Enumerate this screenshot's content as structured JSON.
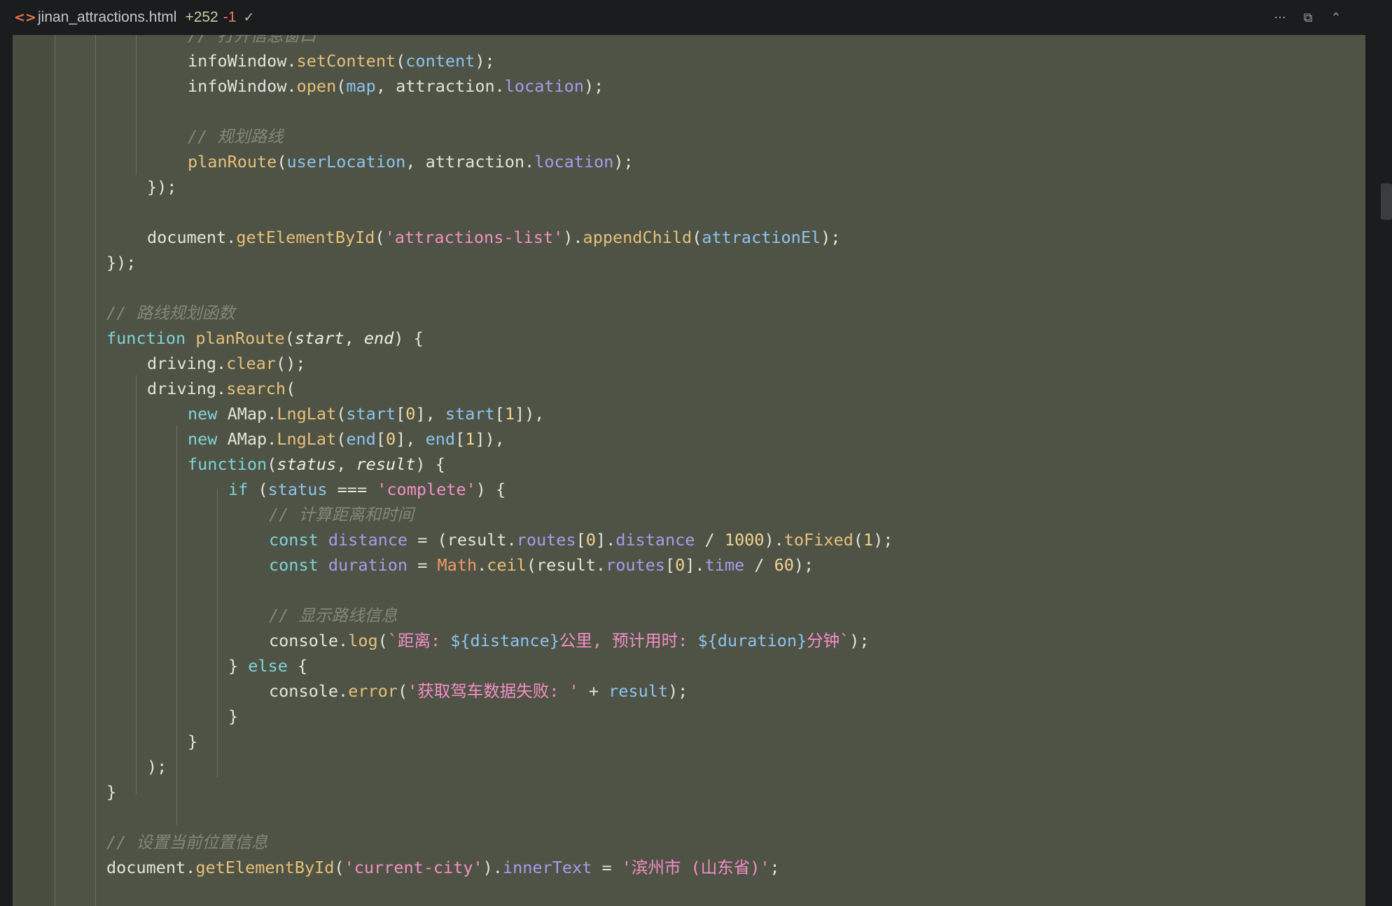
{
  "tab": {
    "file_icon": "code-icon",
    "filename": "jinan_attractions.html",
    "added": "+252",
    "removed": "-1",
    "status_icon": "check-icon",
    "status_glyph": "✓"
  },
  "toolbar": {
    "more_glyph": "···",
    "copy_glyph": "⧉",
    "expand_glyph": "⌃"
  },
  "code_lines": [
    [
      {
        "t": "// 打开信息窗口",
        "c": "c"
      }
    ],
    [
      {
        "t": "infoWindow."
      },
      {
        "t": "setContent",
        "c": "f"
      },
      {
        "t": "("
      },
      {
        "t": "content",
        "c": "p"
      },
      {
        "t": ");"
      }
    ],
    [
      {
        "t": "infoWindow."
      },
      {
        "t": "open",
        "c": "f"
      },
      {
        "t": "("
      },
      {
        "t": "map",
        "c": "p"
      },
      {
        "t": ", attraction."
      },
      {
        "t": "location",
        "c": "pr"
      },
      {
        "t": ");"
      }
    ],
    [],
    [
      {
        "t": "// 规划路线",
        "c": "c"
      }
    ],
    [
      {
        "t": "planRoute",
        "c": "f"
      },
      {
        "t": "("
      },
      {
        "t": "userLocation",
        "c": "p"
      },
      {
        "t": ", attraction."
      },
      {
        "t": "location",
        "c": "pr"
      },
      {
        "t": ");"
      }
    ],
    [
      {
        "t": "});"
      }
    ],
    [],
    [
      {
        "t": "document."
      },
      {
        "t": "getElementById",
        "c": "f"
      },
      {
        "t": "("
      },
      {
        "t": "'attractions-list'",
        "c": "s"
      },
      {
        "t": ")."
      },
      {
        "t": "appendChild",
        "c": "f"
      },
      {
        "t": "("
      },
      {
        "t": "attractionEl",
        "c": "p"
      },
      {
        "t": ");"
      }
    ],
    [
      {
        "t": "});"
      }
    ],
    [],
    [
      {
        "t": "// 路线规划函数",
        "c": "c"
      }
    ],
    [
      {
        "t": "function ",
        "c": "k"
      },
      {
        "t": "planRoute",
        "c": "f"
      },
      {
        "t": "("
      },
      {
        "t": "start",
        "c": "i"
      },
      {
        "t": ", "
      },
      {
        "t": "end",
        "c": "i"
      },
      {
        "t": ") {"
      }
    ],
    [
      {
        "t": "driving."
      },
      {
        "t": "clear",
        "c": "f"
      },
      {
        "t": "();"
      }
    ],
    [
      {
        "t": "driving."
      },
      {
        "t": "search",
        "c": "f"
      },
      {
        "t": "("
      }
    ],
    [
      {
        "t": "new ",
        "c": "k"
      },
      {
        "t": "AMap."
      },
      {
        "t": "LngLat",
        "c": "f"
      },
      {
        "t": "("
      },
      {
        "t": "start",
        "c": "p"
      },
      {
        "t": "["
      },
      {
        "t": "0",
        "c": "n"
      },
      {
        "t": "], "
      },
      {
        "t": "start",
        "c": "p"
      },
      {
        "t": "["
      },
      {
        "t": "1",
        "c": "n"
      },
      {
        "t": "]),"
      }
    ],
    [
      {
        "t": "new ",
        "c": "k"
      },
      {
        "t": "AMap."
      },
      {
        "t": "LngLat",
        "c": "f"
      },
      {
        "t": "("
      },
      {
        "t": "end",
        "c": "p"
      },
      {
        "t": "["
      },
      {
        "t": "0",
        "c": "n"
      },
      {
        "t": "], "
      },
      {
        "t": "end",
        "c": "p"
      },
      {
        "t": "["
      },
      {
        "t": "1",
        "c": "n"
      },
      {
        "t": "]),"
      }
    ],
    [
      {
        "t": "function",
        "c": "k"
      },
      {
        "t": "("
      },
      {
        "t": "status",
        "c": "i"
      },
      {
        "t": ", "
      },
      {
        "t": "result",
        "c": "i"
      },
      {
        "t": ") {"
      }
    ],
    [
      {
        "t": "if ",
        "c": "k"
      },
      {
        "t": "("
      },
      {
        "t": "status",
        "c": "p"
      },
      {
        "t": " === "
      },
      {
        "t": "'complete'",
        "c": "s"
      },
      {
        "t": ") {"
      }
    ],
    [
      {
        "t": "// 计算距离和时间",
        "c": "c"
      }
    ],
    [
      {
        "t": "const ",
        "c": "k"
      },
      {
        "t": "distance",
        "c": "pr"
      },
      {
        "t": " = (result."
      },
      {
        "t": "routes",
        "c": "pr"
      },
      {
        "t": "["
      },
      {
        "t": "0",
        "c": "n"
      },
      {
        "t": "]."
      },
      {
        "t": "distance",
        "c": "pr"
      },
      {
        "t": " / "
      },
      {
        "t": "1000",
        "c": "n"
      },
      {
        "t": ")."
      },
      {
        "t": "toFixed",
        "c": "f"
      },
      {
        "t": "("
      },
      {
        "t": "1",
        "c": "n"
      },
      {
        "t": ");"
      }
    ],
    [
      {
        "t": "const ",
        "c": "k"
      },
      {
        "t": "duration",
        "c": "pr"
      },
      {
        "t": " = "
      },
      {
        "t": "Math",
        "c": "o"
      },
      {
        "t": "."
      },
      {
        "t": "ceil",
        "c": "f"
      },
      {
        "t": "(result."
      },
      {
        "t": "routes",
        "c": "pr"
      },
      {
        "t": "["
      },
      {
        "t": "0",
        "c": "n"
      },
      {
        "t": "]."
      },
      {
        "t": "time",
        "c": "pr"
      },
      {
        "t": " / "
      },
      {
        "t": "60",
        "c": "n"
      },
      {
        "t": ");"
      }
    ],
    [],
    [
      {
        "t": "// 显示路线信息",
        "c": "c"
      }
    ],
    [
      {
        "t": "console."
      },
      {
        "t": "log",
        "c": "f"
      },
      {
        "t": "("
      },
      {
        "t": "`距离: ",
        "c": "s"
      },
      {
        "t": "${distance}",
        "c": "tp"
      },
      {
        "t": "公里, 预计用时: ",
        "c": "s"
      },
      {
        "t": "${duration}",
        "c": "tp"
      },
      {
        "t": "分钟`",
        "c": "s"
      },
      {
        "t": ");"
      }
    ],
    [
      {
        "t": "} "
      },
      {
        "t": "else",
        "c": "k"
      },
      {
        "t": " {"
      }
    ],
    [
      {
        "t": "console."
      },
      {
        "t": "error",
        "c": "f"
      },
      {
        "t": "("
      },
      {
        "t": "'获取驾车数据失败: '",
        "c": "s"
      },
      {
        "t": " + "
      },
      {
        "t": "result",
        "c": "p"
      },
      {
        "t": ");"
      }
    ],
    [
      {
        "t": "}"
      }
    ],
    [
      {
        "t": "}"
      }
    ],
    [
      {
        "t": ");"
      }
    ],
    [
      {
        "t": "}"
      }
    ],
    [],
    [
      {
        "t": "// 设置当前位置信息",
        "c": "c"
      }
    ],
    [
      {
        "t": "document."
      },
      {
        "t": "getElementById",
        "c": "f"
      },
      {
        "t": "("
      },
      {
        "t": "'current-city'",
        "c": "s"
      },
      {
        "t": ")."
      },
      {
        "t": "innerText",
        "c": "pr"
      },
      {
        "t": " = "
      },
      {
        "t": "'滨州市 (山东省)'",
        "c": "s"
      },
      {
        "t": ";"
      }
    ]
  ]
}
